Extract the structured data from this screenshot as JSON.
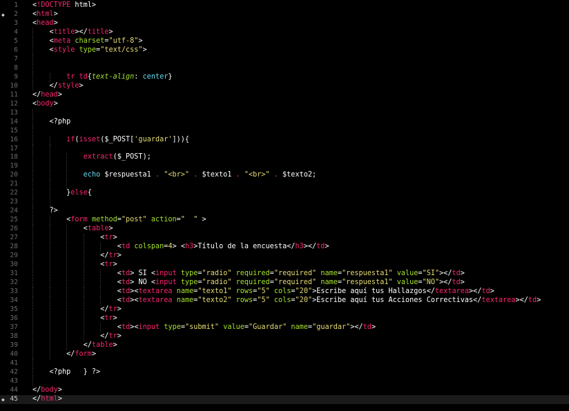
{
  "editor": {
    "current_line": 45,
    "colors": {
      "background": "#000000",
      "tag": "#f92672",
      "attribute": "#a6e22e",
      "string": "#e6db74",
      "function": "#66d9ef",
      "line_number": "#6b6b6b"
    },
    "marker_lines": [
      2,
      45
    ],
    "lines": [
      {
        "n": "1",
        "indent": 0,
        "tokens": [
          [
            "p",
            "<"
          ],
          [
            "t",
            "!DOCTYPE"
          ],
          [
            "p",
            " html>"
          ]
        ]
      },
      {
        "n": "2",
        "indent": 0,
        "tokens": [
          [
            "p",
            "<"
          ],
          [
            "t",
            "html"
          ],
          [
            "p",
            ">"
          ]
        ]
      },
      {
        "n": "3",
        "indent": 0,
        "tokens": [
          [
            "p",
            "<"
          ],
          [
            "t",
            "head"
          ],
          [
            "p",
            ">"
          ]
        ]
      },
      {
        "n": "4",
        "indent": 1,
        "tokens": [
          [
            "p",
            "<"
          ],
          [
            "t",
            "title"
          ],
          [
            "p",
            "></"
          ],
          [
            "t",
            "title"
          ],
          [
            "p",
            ">"
          ]
        ]
      },
      {
        "n": "5",
        "indent": 1,
        "tokens": [
          [
            "p",
            "<"
          ],
          [
            "t",
            "meta"
          ],
          [
            "p",
            " "
          ],
          [
            "a",
            "charset"
          ],
          [
            "p",
            "="
          ],
          [
            "s",
            "\"utf-8\""
          ],
          [
            "p",
            ">"
          ]
        ]
      },
      {
        "n": "6",
        "indent": 1,
        "tokens": [
          [
            "p",
            "<"
          ],
          [
            "t",
            "style"
          ],
          [
            "p",
            " "
          ],
          [
            "a",
            "type"
          ],
          [
            "p",
            "="
          ],
          [
            "s",
            "\"text/css\""
          ],
          [
            "p",
            ">"
          ]
        ]
      },
      {
        "n": "7",
        "indent": 1,
        "tokens": []
      },
      {
        "n": "8",
        "indent": 1,
        "tokens": []
      },
      {
        "n": "9",
        "indent": 2,
        "tokens": [
          [
            "t",
            "tr td"
          ],
          [
            "p",
            "{"
          ],
          [
            "i",
            "text-align"
          ],
          [
            "p",
            ": "
          ],
          [
            "c",
            "center"
          ],
          [
            "p",
            "}"
          ]
        ]
      },
      {
        "n": "10",
        "indent": 1,
        "tokens": [
          [
            "p",
            "</"
          ],
          [
            "t",
            "style"
          ],
          [
            "p",
            ">"
          ]
        ]
      },
      {
        "n": "11",
        "indent": 0,
        "tokens": [
          [
            "p",
            "</"
          ],
          [
            "t",
            "head"
          ],
          [
            "p",
            ">"
          ]
        ]
      },
      {
        "n": "12",
        "indent": 0,
        "tokens": [
          [
            "p",
            "<"
          ],
          [
            "t",
            "body"
          ],
          [
            "p",
            ">"
          ]
        ]
      },
      {
        "n": "13",
        "indent": 1,
        "tokens": []
      },
      {
        "n": "14",
        "indent": 1,
        "tokens": [
          [
            "p",
            "<?php"
          ]
        ]
      },
      {
        "n": "15",
        "indent": 1,
        "tokens": []
      },
      {
        "n": "16",
        "indent": 2,
        "tokens": [
          [
            "k",
            "if"
          ],
          [
            "p",
            "("
          ],
          [
            "k",
            "isset"
          ],
          [
            "p",
            "("
          ],
          [
            "v",
            "$_POST"
          ],
          [
            "p",
            "["
          ],
          [
            "s",
            "'guardar'"
          ],
          [
            "p",
            "])){"
          ]
        ]
      },
      {
        "n": "17",
        "indent": 2,
        "tokens": []
      },
      {
        "n": "18",
        "indent": 3,
        "tokens": [
          [
            "k",
            "extract"
          ],
          [
            "p",
            "("
          ],
          [
            "v",
            "$_POST"
          ],
          [
            "p",
            ");"
          ]
        ]
      },
      {
        "n": "19",
        "indent": 3,
        "tokens": []
      },
      {
        "n": "20",
        "indent": 3,
        "tokens": [
          [
            "f",
            "echo"
          ],
          [
            "p",
            " $respuesta1 "
          ],
          [
            "t",
            "."
          ],
          [
            "p",
            " "
          ],
          [
            "s",
            "\"<br>\""
          ],
          [
            "p",
            " "
          ],
          [
            "t",
            "."
          ],
          [
            "p",
            " $texto1 "
          ],
          [
            "t",
            "."
          ],
          [
            "p",
            " "
          ],
          [
            "s",
            "\"<br>\""
          ],
          [
            "p",
            " "
          ],
          [
            "t",
            "."
          ],
          [
            "p",
            " $texto2;"
          ]
        ]
      },
      {
        "n": "21",
        "indent": 3,
        "tokens": []
      },
      {
        "n": "22",
        "indent": 2,
        "tokens": [
          [
            "p",
            "}"
          ],
          [
            "k",
            "else"
          ],
          [
            "p",
            "{"
          ]
        ]
      },
      {
        "n": "23",
        "indent": 2,
        "tokens": []
      },
      {
        "n": "24",
        "indent": 1,
        "tokens": [
          [
            "p",
            "?>"
          ]
        ]
      },
      {
        "n": "25",
        "indent": 2,
        "tokens": [
          [
            "p",
            "<"
          ],
          [
            "t",
            "form"
          ],
          [
            "p",
            " "
          ],
          [
            "a",
            "method"
          ],
          [
            "p",
            "="
          ],
          [
            "s",
            "\"post\""
          ],
          [
            "p",
            " "
          ],
          [
            "a",
            "action"
          ],
          [
            "p",
            "="
          ],
          [
            "s",
            "\"  \""
          ],
          [
            "p",
            " >"
          ]
        ]
      },
      {
        "n": "26",
        "indent": 3,
        "tokens": [
          [
            "p",
            "<"
          ],
          [
            "t",
            "table"
          ],
          [
            "p",
            ">"
          ]
        ]
      },
      {
        "n": "27",
        "indent": 4,
        "tokens": [
          [
            "p",
            "<"
          ],
          [
            "t",
            "tr"
          ],
          [
            "p",
            ">"
          ]
        ]
      },
      {
        "n": "28",
        "indent": 5,
        "tokens": [
          [
            "p",
            "<"
          ],
          [
            "t",
            "td"
          ],
          [
            "p",
            " "
          ],
          [
            "a",
            "colspan"
          ],
          [
            "p",
            "="
          ],
          [
            "s",
            "4"
          ],
          [
            "p",
            "> <"
          ],
          [
            "t",
            "h3"
          ],
          [
            "p",
            ">Título de la encuesta</"
          ],
          [
            "t",
            "h3"
          ],
          [
            "p",
            "></"
          ],
          [
            "t",
            "td"
          ],
          [
            "p",
            ">"
          ]
        ]
      },
      {
        "n": "29",
        "indent": 4,
        "tokens": [
          [
            "p",
            "</"
          ],
          [
            "t",
            "tr"
          ],
          [
            "p",
            ">"
          ]
        ]
      },
      {
        "n": "30",
        "indent": 4,
        "tokens": [
          [
            "p",
            "<"
          ],
          [
            "t",
            "tr"
          ],
          [
            "p",
            ">"
          ]
        ]
      },
      {
        "n": "31",
        "indent": 5,
        "tokens": [
          [
            "p",
            "<"
          ],
          [
            "t",
            "td"
          ],
          [
            "p",
            "> SI <"
          ],
          [
            "t",
            "input"
          ],
          [
            "p",
            " "
          ],
          [
            "a",
            "type"
          ],
          [
            "p",
            "="
          ],
          [
            "s",
            "\"radio\""
          ],
          [
            "p",
            " "
          ],
          [
            "a",
            "required"
          ],
          [
            "p",
            "="
          ],
          [
            "s",
            "\"required\""
          ],
          [
            "p",
            " "
          ],
          [
            "a",
            "name"
          ],
          [
            "p",
            "="
          ],
          [
            "s",
            "\"respuesta1\""
          ],
          [
            "p",
            " "
          ],
          [
            "a",
            "value"
          ],
          [
            "p",
            "="
          ],
          [
            "s",
            "\"SI\""
          ],
          [
            "p",
            "></"
          ],
          [
            "t",
            "td"
          ],
          [
            "p",
            ">"
          ]
        ]
      },
      {
        "n": "32",
        "indent": 5,
        "tokens": [
          [
            "p",
            "<"
          ],
          [
            "t",
            "td"
          ],
          [
            "p",
            "> NO <"
          ],
          [
            "t",
            "input"
          ],
          [
            "p",
            " "
          ],
          [
            "a",
            "type"
          ],
          [
            "p",
            "="
          ],
          [
            "s",
            "\"radio\""
          ],
          [
            "p",
            " "
          ],
          [
            "a",
            "required"
          ],
          [
            "p",
            "="
          ],
          [
            "s",
            "\"required\""
          ],
          [
            "p",
            " "
          ],
          [
            "a",
            "name"
          ],
          [
            "p",
            "="
          ],
          [
            "s",
            "\"respuesta1\""
          ],
          [
            "p",
            " "
          ],
          [
            "a",
            "value"
          ],
          [
            "p",
            "="
          ],
          [
            "s",
            "\"NO\""
          ],
          [
            "p",
            "></"
          ],
          [
            "t",
            "td"
          ],
          [
            "p",
            ">"
          ]
        ]
      },
      {
        "n": "33",
        "indent": 5,
        "tokens": [
          [
            "p",
            "<"
          ],
          [
            "t",
            "td"
          ],
          [
            "p",
            "><"
          ],
          [
            "t",
            "textarea"
          ],
          [
            "p",
            " "
          ],
          [
            "a",
            "name"
          ],
          [
            "p",
            "="
          ],
          [
            "s",
            "\"texto1\""
          ],
          [
            "p",
            " "
          ],
          [
            "a",
            "rows"
          ],
          [
            "p",
            "="
          ],
          [
            "s",
            "\"5\""
          ],
          [
            "p",
            " "
          ],
          [
            "a",
            "cols"
          ],
          [
            "p",
            "="
          ],
          [
            "s",
            "\"20\""
          ],
          [
            "p",
            ">Escribe aquí tus Hallazgos</"
          ],
          [
            "t",
            "textarea"
          ],
          [
            "p",
            "></"
          ],
          [
            "t",
            "td"
          ],
          [
            "p",
            ">"
          ]
        ]
      },
      {
        "n": "34",
        "indent": 5,
        "tokens": [
          [
            "p",
            "<"
          ],
          [
            "t",
            "td"
          ],
          [
            "p",
            "><"
          ],
          [
            "t",
            "textarea"
          ],
          [
            "p",
            " "
          ],
          [
            "a",
            "name"
          ],
          [
            "p",
            "="
          ],
          [
            "s",
            "\"texto2\""
          ],
          [
            "p",
            " "
          ],
          [
            "a",
            "rows"
          ],
          [
            "p",
            "="
          ],
          [
            "s",
            "\"5\""
          ],
          [
            "p",
            " "
          ],
          [
            "a",
            "cols"
          ],
          [
            "p",
            "="
          ],
          [
            "s",
            "\"20\""
          ],
          [
            "p",
            ">Escribe aquí tus Acciones Correctivas</"
          ],
          [
            "t",
            "textarea"
          ],
          [
            "p",
            "></"
          ],
          [
            "t",
            "td"
          ],
          [
            "p",
            ">"
          ]
        ]
      },
      {
        "n": "35",
        "indent": 4,
        "tokens": [
          [
            "p",
            "</"
          ],
          [
            "t",
            "tr"
          ],
          [
            "p",
            ">"
          ]
        ]
      },
      {
        "n": "36",
        "indent": 4,
        "tokens": [
          [
            "p",
            "<"
          ],
          [
            "t",
            "tr"
          ],
          [
            "p",
            ">"
          ]
        ]
      },
      {
        "n": "37",
        "indent": 5,
        "tokens": [
          [
            "p",
            "<"
          ],
          [
            "t",
            "td"
          ],
          [
            "p",
            "><"
          ],
          [
            "t",
            "input"
          ],
          [
            "p",
            " "
          ],
          [
            "a",
            "type"
          ],
          [
            "p",
            "="
          ],
          [
            "s",
            "\"submit\""
          ],
          [
            "p",
            " "
          ],
          [
            "a",
            "value"
          ],
          [
            "p",
            "="
          ],
          [
            "s",
            "\"Guardar\""
          ],
          [
            "p",
            " "
          ],
          [
            "a",
            "name"
          ],
          [
            "p",
            "="
          ],
          [
            "s",
            "\"guardar\""
          ],
          [
            "p",
            "></"
          ],
          [
            "t",
            "td"
          ],
          [
            "p",
            ">"
          ]
        ]
      },
      {
        "n": "38",
        "indent": 4,
        "tokens": [
          [
            "p",
            "</"
          ],
          [
            "t",
            "tr"
          ],
          [
            "p",
            ">"
          ]
        ]
      },
      {
        "n": "39",
        "indent": 3,
        "tokens": [
          [
            "p",
            "</"
          ],
          [
            "t",
            "table"
          ],
          [
            "p",
            ">"
          ]
        ]
      },
      {
        "n": "40",
        "indent": 2,
        "tokens": [
          [
            "p",
            "</"
          ],
          [
            "t",
            "form"
          ],
          [
            "p",
            ">"
          ]
        ]
      },
      {
        "n": "41",
        "indent": 1,
        "tokens": []
      },
      {
        "n": "42",
        "indent": 1,
        "tokens": [
          [
            "p",
            "<?php   } ?>"
          ]
        ]
      },
      {
        "n": "43",
        "indent": 1,
        "tokens": []
      },
      {
        "n": "44",
        "indent": 0,
        "tokens": [
          [
            "p",
            "</"
          ],
          [
            "t",
            "body"
          ],
          [
            "p",
            ">"
          ]
        ]
      },
      {
        "n": "45",
        "indent": 0,
        "tokens": [
          [
            "p",
            "</"
          ],
          [
            "t",
            "html"
          ],
          [
            "p",
            ">"
          ]
        ]
      }
    ]
  }
}
